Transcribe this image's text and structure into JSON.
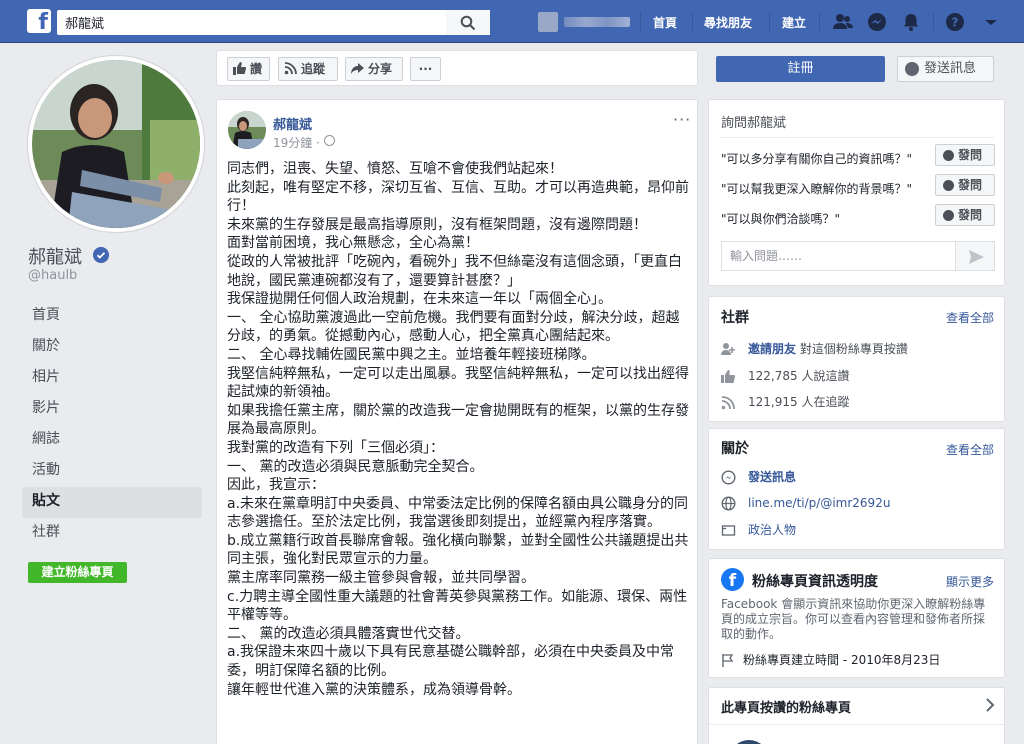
{
  "topbar": {
    "search_value": "郝龍斌",
    "nav": [
      "首頁",
      "尋找朋友",
      "建立"
    ]
  },
  "profile": {
    "name": "郝龍斌",
    "handle": "@haulb"
  },
  "left_nav": [
    {
      "label": "首頁",
      "active": false
    },
    {
      "label": "關於",
      "active": false
    },
    {
      "label": "相片",
      "active": false
    },
    {
      "label": "影片",
      "active": false
    },
    {
      "label": "網誌",
      "active": false
    },
    {
      "label": "活動",
      "active": false
    },
    {
      "label": "貼文",
      "active": true
    },
    {
      "label": "社群",
      "active": false
    }
  ],
  "create_page_label": "建立粉絲專頁",
  "action_bar": {
    "like": "讚",
    "follow": "追蹤",
    "share": "分享",
    "more": "···"
  },
  "register_label": "註冊",
  "send_message_label": "發送訊息",
  "post": {
    "author": "郝龍斌",
    "time": "19分鐘 ·",
    "more": "···",
    "lines": [
      "同志們，沮喪、失望、憤怒、互嗆不會使我們站起來！",
      "此刻起，唯有堅定不移，深切互省、互信、互助。才可以再造典範，昂仰前行！",
      "未來黨的生存發展是最高指導原則，沒有框架問題，沒有邊際問題！",
      "面對當前困境，我心無懸念，全心為黨！",
      "從政的人常被批評「吃碗內，看碗外」我不但絲毫沒有這個念頭，「更直白地說，國民黨連碗都沒有了，還要算計甚麼？」",
      "我保證拋開任何個人政治規劃，在未來這一年以「兩個全心」。",
      "一、 全心協助黨渡過此一空前危機。我們要有面對分歧，解決分歧，超越分歧，的勇氣。從撼動內心，感動人心，把全黨真心團結起來。",
      "二、 全心尋找輔佐國民黨中興之主。並培養年輕接班梯隊。",
      "我堅信純粹無私，一定可以走出風暴。我堅信純粹無私，一定可以找出經得起試煉的新領袖。",
      "如果我擔任黨主席，關於黨的改造我一定會拋開既有的框架，以黨的生存發展為最高原則。",
      "我對黨的改造有下列「三個必須」：",
      "一、 黨的改造必須與民意脈動完全契合。",
      "因此，我宣示：",
      "a.未來在黨章明訂中央委員、中常委法定比例的保障名額由具公職身分的同志參選擔任。至於法定比例，我當選後即刻提出，並經黨內程序落實。",
      "b.成立黨籍行政首長聯席會報。強化橫向聯繫，並對全國性公共議題提出共同主張，強化對民眾宣示的力量。",
      "黨主席率同黨務一級主管參與會報，並共同學習。",
      "c.力聘主導全國性重大議題的社會菁英參與黨務工作。如能源、環保、兩性平權等等。",
      "二、 黨的改造必須具體落實世代交替。",
      "a.我保證未來四十歲以下具有民意基礎公職幹部，必須在中央委員及中常委，明訂保障名額的比例。",
      "讓年輕世代進入黨的決策體系，成為領導骨幹。"
    ]
  },
  "ask_card": {
    "title": "詢問郝龍斌",
    "questions": [
      "\"可以多分享有關你自己的資訊嗎？\"",
      "\"可以幫我更深入瞭解你的背景嗎？\"",
      "\"可以與你們洽談嗎？\""
    ],
    "ask_label": "發問",
    "input_placeholder": "輸入問題……"
  },
  "community_card": {
    "title": "社群",
    "see_all": "查看全部",
    "invite_link": "邀請朋友",
    "invite_rest": "對這個粉絲專頁按讚",
    "likes": "122,785 人說這讚",
    "follows": "121,915 人在追蹤"
  },
  "about_card": {
    "title": "關於",
    "see_all": "查看全部",
    "send_message": "發送訊息",
    "website": "line.me/ti/p/@imr2692u",
    "category": "政治人物"
  },
  "transparency_card": {
    "title": "粉絲專頁資訊透明度",
    "show_more": "顯示更多",
    "description": "Facebook 會顯示資訊來協助你更深入瞭解粉絲專頁的成立宗旨。你可以查看內容管理和發佈者所採取的動作。",
    "created": "粉絲專頁建立時間 - 2010年8月23日"
  },
  "liked_pages_card": {
    "title": "此專頁按讚的粉絲專頁"
  }
}
